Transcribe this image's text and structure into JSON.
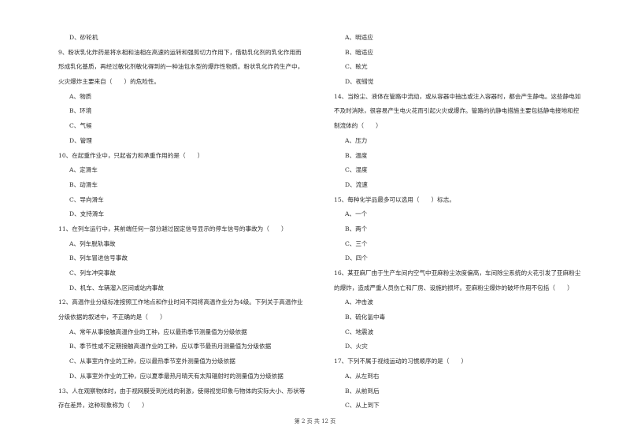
{
  "left_column": [
    {
      "type": "option",
      "text": "D、砂轮机"
    },
    {
      "type": "question",
      "lines": [
        "9、粉状乳化炸药是将水相和油相在高速的运转和强剪切力作用下，借助乳化剂的乳化作用而",
        "形成乳化基质，再经过敏化剂敏化得到的一种油包水型的爆炸性物质。粉状乳化炸药生产中，",
        "火灾爆炸主要来自（　　）的危险性。"
      ]
    },
    {
      "type": "option",
      "text": "A、物质"
    },
    {
      "type": "option",
      "text": "B、环境"
    },
    {
      "type": "option",
      "text": "C、气候"
    },
    {
      "type": "option",
      "text": "D、管理"
    },
    {
      "type": "question",
      "lines": [
        "10、在起重作业中，只起省力和承重作用的是（　　）"
      ]
    },
    {
      "type": "option",
      "text": "A、定滑车"
    },
    {
      "type": "option",
      "text": "B、动滑车"
    },
    {
      "type": "option",
      "text": "C、导向滑车"
    },
    {
      "type": "option",
      "text": "D、支持滑车"
    },
    {
      "type": "question",
      "lines": [
        "11、在列车运行中，其前端任何一部分越过固定信号显示的停车信号的事故为（　　）"
      ]
    },
    {
      "type": "option",
      "text": "A、列车脱轨事故"
    },
    {
      "type": "option",
      "text": "B、列车冒进信号事故"
    },
    {
      "type": "option",
      "text": "C、列车冲突事故"
    },
    {
      "type": "option",
      "text": "D、机车、车辆溜入区间或站内事故"
    },
    {
      "type": "question",
      "lines": [
        "12、高温作业分级标准按照工作地点和作业时间不同将高温作业分为4级。下列关于高温作业",
        "分级依据的叙述中，不正确的是（　　）"
      ]
    },
    {
      "type": "option",
      "text": "A、常年从事接触高温作业的工种，应以最热季节测量值为分级依据"
    },
    {
      "type": "option",
      "text": "B、季节性或不定期接触高温作业的工种，应以季节最热月测量值为分级依据"
    },
    {
      "type": "option",
      "text": "C、从事室内作业的工种，应以最热季节室外测量值为分级依据"
    },
    {
      "type": "option",
      "text": "D、从事室外作业的工种，应以夏季最热月晴天有太阳辐射时的测量值为分级依据"
    },
    {
      "type": "question",
      "lines": [
        "13、人在观察物体时，由于视网膜受到光线的刺激，使得视觉印象与物体的实际大小、形状等",
        "存在差异，这种现象称为（　　）"
      ]
    }
  ],
  "right_column": [
    {
      "type": "option",
      "text": "A、明适应"
    },
    {
      "type": "option",
      "text": "B、暗适应"
    },
    {
      "type": "option",
      "text": "C、眩光"
    },
    {
      "type": "option",
      "text": "D、视错觉"
    },
    {
      "type": "question",
      "lines": [
        "14、当粉尘、液体在管路中流动，或从容器中抽出或注入容器时，都会产生静电。这些静电如",
        "不及时消除，很容易产生电火花而引起火灾或爆炸。管路的抗静电措施主要包括静电接地和控",
        "制流体的（　　）"
      ]
    },
    {
      "type": "option",
      "text": "A、压力"
    },
    {
      "type": "option",
      "text": "B、温度"
    },
    {
      "type": "option",
      "text": "C、湿度"
    },
    {
      "type": "option",
      "text": "D、流速"
    },
    {
      "type": "question",
      "lines": [
        "15、每种化学品最多可以选用（　　）标志。"
      ]
    },
    {
      "type": "option",
      "text": "A、一个"
    },
    {
      "type": "option",
      "text": "B、两个"
    },
    {
      "type": "option",
      "text": "C、三个"
    },
    {
      "type": "option",
      "text": "D、四个"
    },
    {
      "type": "question",
      "lines": [
        "16、某亚麻厂由于生产车间内空气中亚麻粉尘浓度偏高，车间除尘系统的火花引发了亚麻粉尘",
        "的爆炸，造成严重人员伤亡和厂房、设施的损坏。亚麻粉尘爆炸的破坏作用不包括（　　）"
      ]
    },
    {
      "type": "option",
      "text": "A、冲击波"
    },
    {
      "type": "option",
      "text": "B、硫化氢中毒"
    },
    {
      "type": "option",
      "text": "C、地震波"
    },
    {
      "type": "option",
      "text": "D、火灾"
    },
    {
      "type": "question",
      "lines": [
        "17、下列不属于视线运动的习惯顺序的是（　　）"
      ]
    },
    {
      "type": "option",
      "text": "A、从左到右"
    },
    {
      "type": "option",
      "text": "B、从前到后"
    },
    {
      "type": "option",
      "text": "C、从上到下"
    }
  ],
  "footer": {
    "page_label": "第 2 页 共 12 页"
  }
}
